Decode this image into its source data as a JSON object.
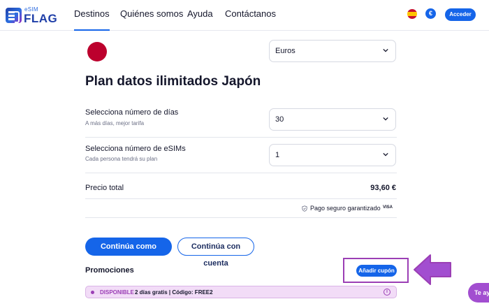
{
  "brand": {
    "small": "eSIM",
    "big": "FLAG"
  },
  "nav": {
    "items": [
      {
        "label": "Destinos",
        "active": true
      },
      {
        "label": "Quiénes somos",
        "active": false
      },
      {
        "label": "Ayuda",
        "active": false
      },
      {
        "label": "Contáctanos",
        "active": false
      }
    ],
    "language_icon": "spain-flag-icon",
    "currency_symbol": "€",
    "login_label": "Acceder"
  },
  "plan": {
    "country_flag_icon": "japan-flag-icon",
    "currency_select": {
      "value": "Euros"
    },
    "title": "Plan datos ilimitados Japón",
    "days": {
      "label": "Selecciona número de días",
      "sublabel": "A más días, mejor tarifa",
      "value": "30"
    },
    "esims": {
      "label": "Selecciona número de eSIMs",
      "sublabel": "Cada persona tendrá su plan",
      "value": "1"
    },
    "total": {
      "label": "Precio total",
      "value": "93,60 €"
    },
    "secure_payment": "Pago seguro garantizado",
    "payment_icon_text": "VISA"
  },
  "actions": {
    "guest_label": "Continúa como invitado",
    "account_label": "Continúa con cuenta"
  },
  "promotions": {
    "label": "Promociones",
    "add_coupon_label": "Añadir cupón",
    "banner": {
      "status": "DISPONIBLE",
      "text": "2 días gratis | Código: FREE2",
      "info_symbol": "i"
    }
  },
  "chat": {
    "label": "Te ay"
  },
  "colors": {
    "primary": "#1565e9",
    "accent_purple": "#9b3fb5",
    "japan_red": "#bc002d"
  }
}
